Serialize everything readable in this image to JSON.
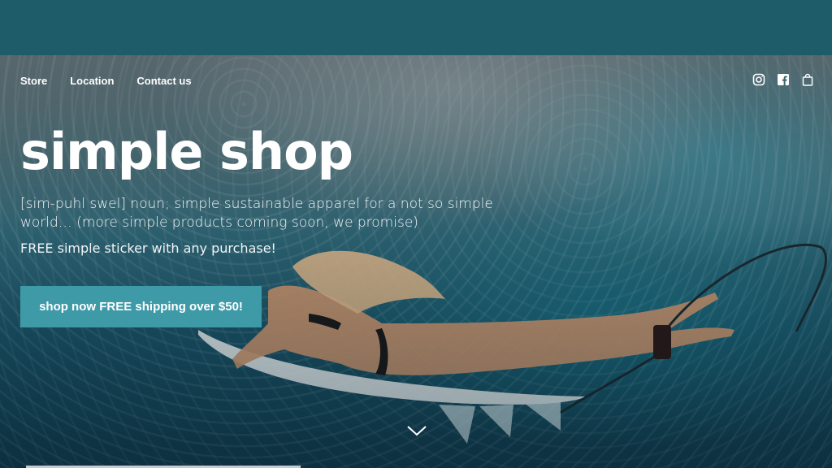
{
  "nav": {
    "items": [
      {
        "label": "Store"
      },
      {
        "label": "Location"
      },
      {
        "label": "Contact us"
      }
    ]
  },
  "header_icons": [
    "instagram-icon",
    "facebook-icon",
    "shopping-bag-icon"
  ],
  "hero": {
    "title": "simple shop",
    "tagline": "[sim-puhl swel] noun; simple sustainable apparel for a not so simple world… (more simple products coming soon, we promise)",
    "promo": "FREE simple sticker with any purchase!",
    "cta_label": "shop now FREE shipping over $50!"
  },
  "colors": {
    "topbar": "#1d5c68",
    "cta": "#3f9aa8",
    "text": "#ffffff"
  }
}
